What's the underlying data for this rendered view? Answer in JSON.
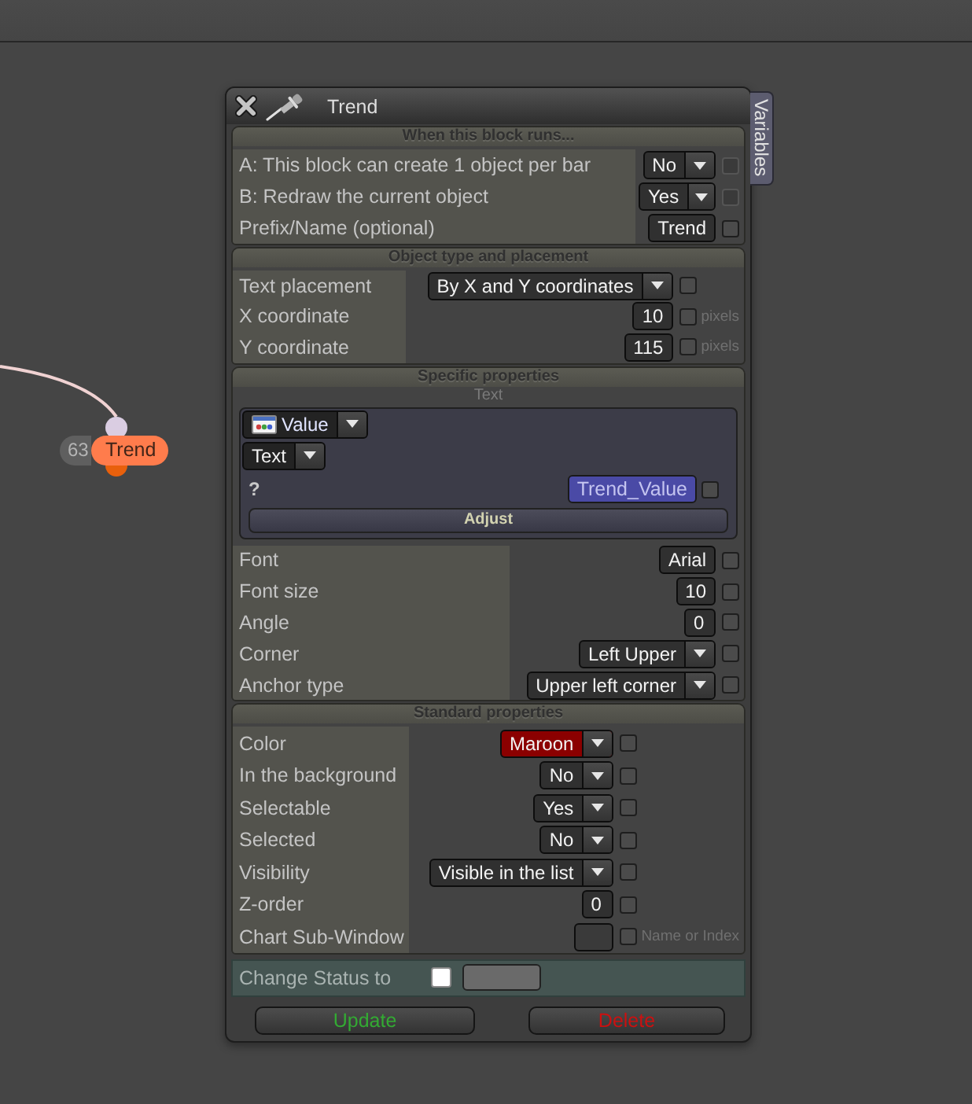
{
  "canvas": {
    "node": {
      "count": "63",
      "label": "Trend"
    }
  },
  "panel": {
    "title": "Trend",
    "side_tab": "Variables",
    "sections": [
      {
        "title": "When this block runs...",
        "rows": [
          {
            "kind": "dropdown",
            "label": "A: This block can create 1 object per bar",
            "value": "No",
            "checked": false,
            "disabled": true
          },
          {
            "kind": "dropdown",
            "label": "B: Redraw the current object",
            "value": "Yes",
            "checked": false,
            "disabled": true
          },
          {
            "kind": "field",
            "label": "Prefix/Name (optional)",
            "value": "Trend",
            "checked": false,
            "disabled": false
          }
        ]
      },
      {
        "title": "Object type and placement",
        "rows": [
          {
            "kind": "dropdown",
            "label": "Text placement",
            "value": "By X and Y coordinates",
            "checked": false,
            "disabled": false
          },
          {
            "kind": "field",
            "label": "X coordinate",
            "value": "10",
            "checked": false,
            "disabled": false,
            "note": "pixels"
          },
          {
            "kind": "field",
            "label": "Y coordinate",
            "value": "115",
            "checked": false,
            "disabled": false,
            "note": "pixels"
          }
        ]
      },
      {
        "title": "Specific properties",
        "subtitle": "Text",
        "editor": {
          "source": "Value",
          "type": "Text",
          "prompt": "?",
          "variable": "Trend_Value",
          "checked": false,
          "button": "Adjust"
        },
        "rows": [
          {
            "kind": "field",
            "label": "Font",
            "value": "Arial",
            "checked": false,
            "disabled": false
          },
          {
            "kind": "field",
            "label": "Font size",
            "value": "10",
            "checked": false,
            "disabled": false
          },
          {
            "kind": "field",
            "label": "Angle",
            "value": "0",
            "checked": false,
            "disabled": false
          },
          {
            "kind": "dropdown",
            "label": "Corner",
            "value": "Left Upper",
            "checked": false,
            "disabled": false
          },
          {
            "kind": "dropdown",
            "label": "Anchor type",
            "value": "Upper left corner",
            "checked": false,
            "disabled": false
          }
        ]
      },
      {
        "title": "Standard properties",
        "rows": [
          {
            "kind": "dropdown",
            "label": "Color",
            "value": "Maroon",
            "color": "#8b0000",
            "checked": false,
            "disabled": false
          },
          {
            "kind": "dropdown",
            "label": "In the background",
            "value": "No",
            "checked": false,
            "disabled": false
          },
          {
            "kind": "dropdown",
            "label": "Selectable",
            "value": "Yes",
            "checked": false,
            "disabled": false
          },
          {
            "kind": "dropdown",
            "label": "Selected",
            "value": "No",
            "checked": false,
            "disabled": false
          },
          {
            "kind": "dropdown",
            "label": "Visibility",
            "value": "Visible in the list",
            "checked": false,
            "disabled": false
          },
          {
            "kind": "field",
            "label": "Z-order",
            "value": "0",
            "checked": false,
            "disabled": false
          },
          {
            "kind": "field",
            "label": "Chart Sub-Window",
            "checked": false,
            "disabled": false,
            "note": "Name or Index"
          }
        ]
      }
    ],
    "status": {
      "label": "Change Status to",
      "checked": false
    },
    "buttons": [
      {
        "kind": "update",
        "label": "Update"
      },
      {
        "kind": "delete",
        "label": "Delete"
      }
    ]
  }
}
